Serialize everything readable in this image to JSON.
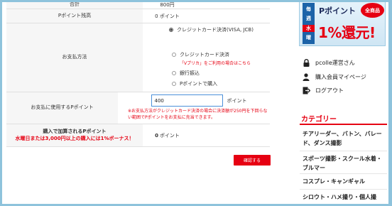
{
  "form": {
    "total": {
      "label": "合計",
      "value": "800円"
    },
    "balance": {
      "label": "Pポイント残高",
      "value": "0 ポイント"
    },
    "payment": {
      "label": "お支払方法",
      "options": [
        {
          "label": "クレジットカード決済(VISA, JCB)",
          "checked": true
        },
        {
          "label": "クレジットカード決済",
          "checked": false
        },
        {
          "label": "銀行振込",
          "checked": false
        },
        {
          "label": "Pポイントで購入",
          "checked": false
        }
      ],
      "vpreca_note": "「Vプリカ」をご利用の場合はこちら"
    },
    "use_points": {
      "label": "お支払に使用するPポイント",
      "input_value": "400",
      "unit": "ポイント",
      "note": "※お支払方法がクレジットカード決済の場合に決済額が250円を下回らない範囲でPポイントをお支払に充当できます。"
    },
    "earned": {
      "label": "購入で加算されるPポイント",
      "bonus_note": "水曜日または3,000円以上の購入には1%ボーナス！",
      "value_number": "0",
      "value_unit": "ポイント"
    },
    "confirm_label": "確認する"
  },
  "banner": {
    "week_chars": [
      "毎",
      "週",
      "水",
      "曜"
    ],
    "title": "Pポイント",
    "badge": "全商品",
    "headline": "1%還元!"
  },
  "sidebar": {
    "links": [
      {
        "label": "pcolle運営さん",
        "icon": "lock-icon"
      },
      {
        "label": "購入会員マイページ",
        "icon": "user-icon"
      },
      {
        "label": "ログアウト",
        "icon": "logout-icon"
      }
    ],
    "category_heading": "カテゴリー",
    "categories": [
      "チアリーダー、バトン、バレード、ダンス撮影",
      "スポーツ撮影・スクール水着・ブルマー",
      "コスプレ・キャンギャル",
      "シロウト・ハメ撮り・個人撮"
    ]
  },
  "colors": {
    "accent_red": "#e60012",
    "frame_blue": "#8ec3dc",
    "banner_blue": "#1c63a8"
  }
}
